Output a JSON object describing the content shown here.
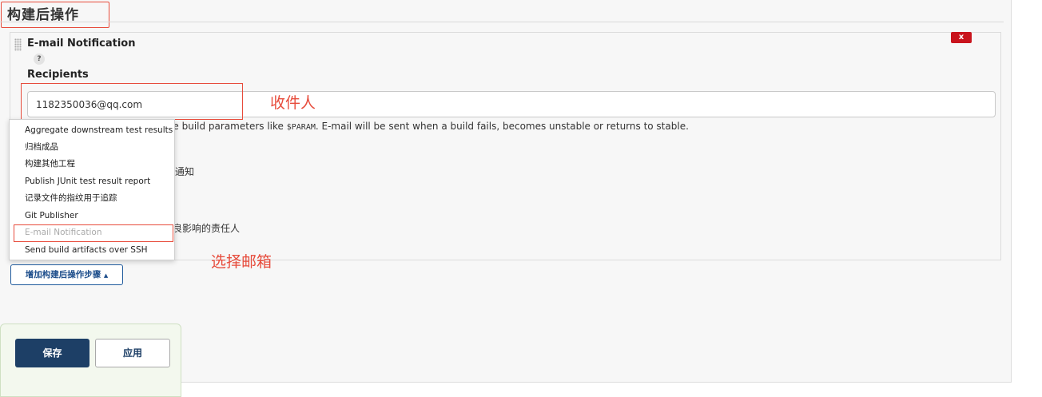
{
  "section": {
    "title": "构建后操作"
  },
  "step": {
    "title": "E-mail Notification",
    "delete_label": "x",
    "help_label": "?",
    "recipients_label": "Recipients",
    "recipients_value": "1182350036@qq.com",
    "help_text_prefix": "pient addresses. May reference build parameters like ",
    "help_text_code": "$PARAM",
    "help_text_suffix": ". E-mail will be sent when a build fails, becomes unstable or returns to stable.",
    "partial_option_1": "通知",
    "partial_option_2": "良影响的责任人"
  },
  "dropdown": {
    "items": [
      {
        "label": "Aggregate downstream test results"
      },
      {
        "label": "归档成品"
      },
      {
        "label": "构建其他工程"
      },
      {
        "label": "Publish JUnit test result report"
      },
      {
        "label": "记录文件的指纹用于追踪"
      },
      {
        "label": "Git Publisher"
      },
      {
        "label": "E-mail Notification",
        "disabled": true
      },
      {
        "label": "Send build artifacts over SSH"
      }
    ]
  },
  "add_step_button": {
    "label": "增加构建后操作步骤",
    "caret": "▲"
  },
  "annotations": {
    "recipient_note": "收件人",
    "select_email_note": "选择邮箱",
    "color": "#e74c3c"
  },
  "footer": {
    "save_label": "保存",
    "apply_label": "应用"
  }
}
